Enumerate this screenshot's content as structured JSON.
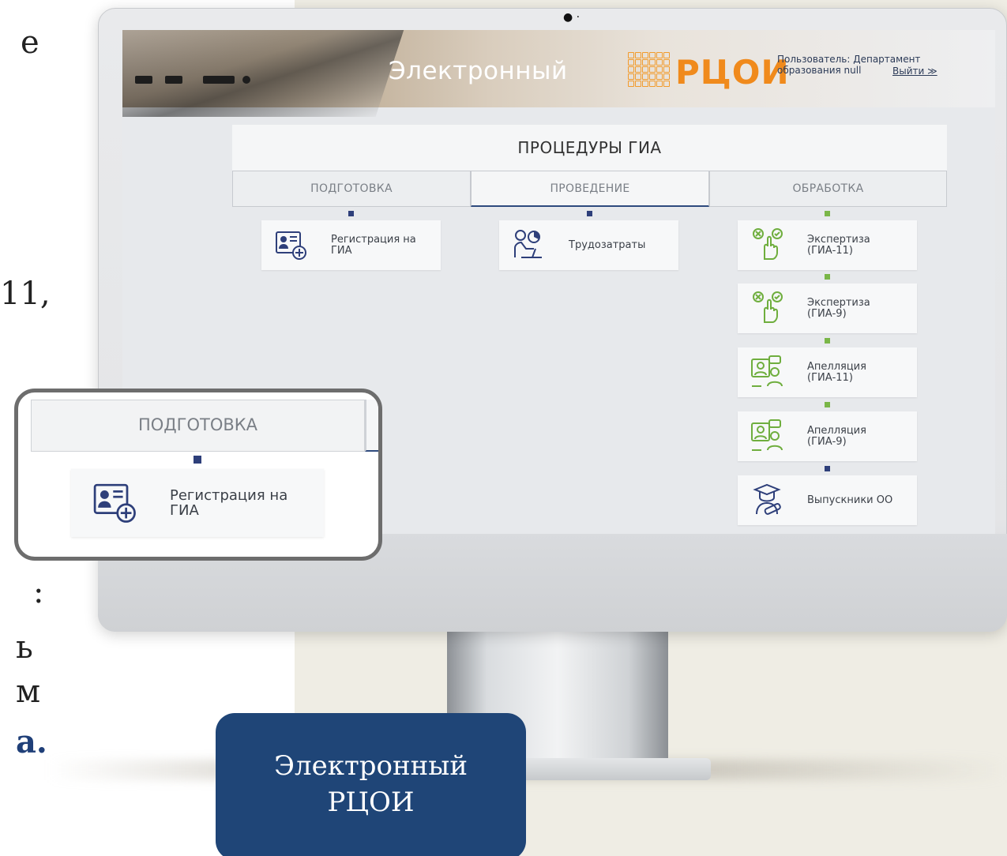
{
  "slide_text": {
    "frag_1": "e",
    "frag_2": "11,",
    "frag_3": ":",
    "frag_4": "ь",
    "frag_5": "м",
    "frag_6": "а."
  },
  "header": {
    "title": "Электронный",
    "logo_text": "РЦОИ",
    "user_line_1": "Пользователь: Департамент",
    "user_line_2": "образования null",
    "logout_label": "Выйти ≫"
  },
  "procedures": {
    "title": "ПРОЦЕДУРЫ ГИА",
    "tabs": [
      {
        "label": "ПОДГОТОВКА"
      },
      {
        "label": "ПРОВЕДЕНИЕ"
      },
      {
        "label": "ОБРАБОТКА"
      }
    ],
    "preparation_cards": [
      {
        "line_1": "Регистрация на",
        "line_2": "ГИА",
        "icon": "registration-icon"
      }
    ],
    "conduct_cards": [
      {
        "line_1": "Трудозатраты",
        "icon": "labor-costs-icon"
      }
    ],
    "processing_cards": [
      {
        "line_1": "Экспертиза",
        "line_2": "(ГИА-11)",
        "icon": "expertise-icon"
      },
      {
        "line_1": "Экспертиза",
        "line_2": "(ГИА-9)",
        "icon": "expertise-icon"
      },
      {
        "line_1": "Апелляция",
        "line_2": "(ГИА-11)",
        "icon": "appeal-icon"
      },
      {
        "line_1": "Апелляция",
        "line_2": "(ГИА-9)",
        "icon": "appeal-icon"
      },
      {
        "line_1": "Выпускники ОО",
        "icon": "graduate-icon"
      }
    ]
  },
  "callout": {
    "tab_label": "ПОДГОТОВКА",
    "card_line_1": "Регистрация на",
    "card_line_2": "ГИА"
  },
  "caption": {
    "line_1": "Электронный",
    "line_2": "РЦОИ"
  },
  "colors": {
    "accent_blue": "#2e3f7a",
    "accent_green": "#7ab648",
    "logo_orange": "#f08a1c",
    "caption_bg": "#1f4577"
  }
}
